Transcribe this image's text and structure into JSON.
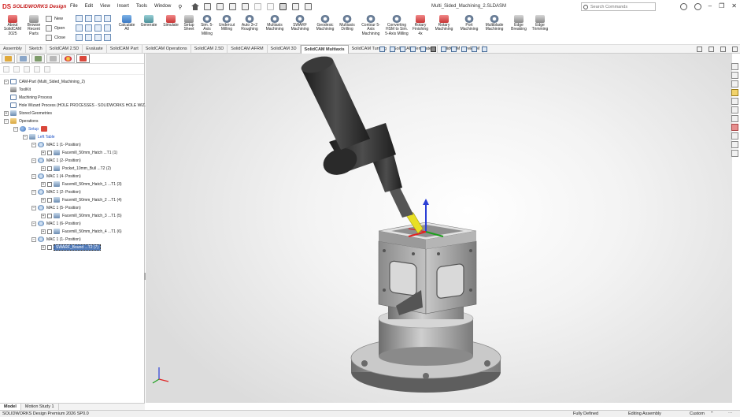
{
  "titlebar": {
    "brand_ds": "DS",
    "brand": "SOLIDWORKS Design",
    "menus": [
      "File",
      "Edit",
      "View",
      "Insert",
      "Tools",
      "Window"
    ],
    "document_title": "Multi_Sided_Machining_2.SLDASM",
    "search_placeholder": "Search Commands"
  },
  "ribbon": {
    "about": "About SolidCAM 2025",
    "browse": "Browse Recent Parts",
    "new": "New",
    "open": "Open",
    "close": "Close",
    "calculate": "Calculate All",
    "generate": "Generate",
    "simulate": "Simulate",
    "setup_sheet": "Setup Sheet",
    "sim5": "Sim. 5-Axis Milling",
    "undercut": "Undercut Milling",
    "auto32": "Auto 3+2 Roughing",
    "multiaxis": "Multiaxis Machining",
    "swarf": "SWARF Machining",
    "geodesic": "Geodesic Machining",
    "drilling": "Multiaxis Drilling",
    "contour": "Contour 5-Axis Machining",
    "converting": "Converting HSM to Sim. 5-Axis Milling",
    "rotary_fin": "Rotary Finishing 4x",
    "rotary": "Rotary Machining",
    "port": "Port Machining",
    "multiblade": "Multiblade Machining",
    "edge_break": "Edge Breaking",
    "edge_trim": "Edge Trimming"
  },
  "tabs": [
    "Assembly",
    "Sketch",
    "SolidCAM 2.5D",
    "Evaluate",
    "SolidCAM Part",
    "SolidCAM Operations",
    "SolidCAM 2.5D",
    "SolidCAM AFRM",
    "SolidCAM 3D",
    "SolidCAM Multiaxis",
    "SolidCAM Turning",
    "SolidCAM Templates",
    "SolidCAM WireEDM"
  ],
  "active_tab_index": 9,
  "tree": {
    "root": "CAM-Part (Multi_Sided_Machining_2)",
    "toolkit": "ToolKit",
    "machining_process": "Machining Process",
    "hole_wizard": "Hole Wizard Process (HOLE PROCESSES - SOLIDWORKS HOLE WIZ...",
    "stored_geometries": "Stored Geometries",
    "operations": "Operations",
    "setup": "Setup",
    "left_table": "Left Table",
    "items": [
      {
        "mac": "MAC 1 (1- Position)",
        "op": "Facemill_50mm_Hatch ...T1 (1)"
      },
      {
        "mac": "MAC 1 (2- Position)",
        "op": "Pocket_10mm_Bull ...T2 (2)"
      },
      {
        "mac": "MAC 1 (4- Position)",
        "op": "Facemill_50mm_Hatch_1 ...T1 (3)"
      },
      {
        "mac": "MAC 1 (2- Position)",
        "op": "Facemill_50mm_Hatch_2 ...T1 (4)"
      },
      {
        "mac": "MAC 1 (5- Position)",
        "op": "Facemill_50mm_Hatch_3 ...T1 (5)"
      },
      {
        "mac": "MAC 1 (6- Position)",
        "op": "Facemill_50mm_Hatch_4 ...T1 (6)"
      },
      {
        "mac": "MAC 1 (1- Position)",
        "op": "SWARF_Bound ...T2 (7)"
      }
    ]
  },
  "bottom_tabs": [
    "Model",
    "Motion Study 1"
  ],
  "status": {
    "product": "SOLIDWORKS Design Premium 2026 SP0.0",
    "fully": "Fully Defined",
    "editing": "Editing Assembly",
    "custom": "Custom"
  }
}
